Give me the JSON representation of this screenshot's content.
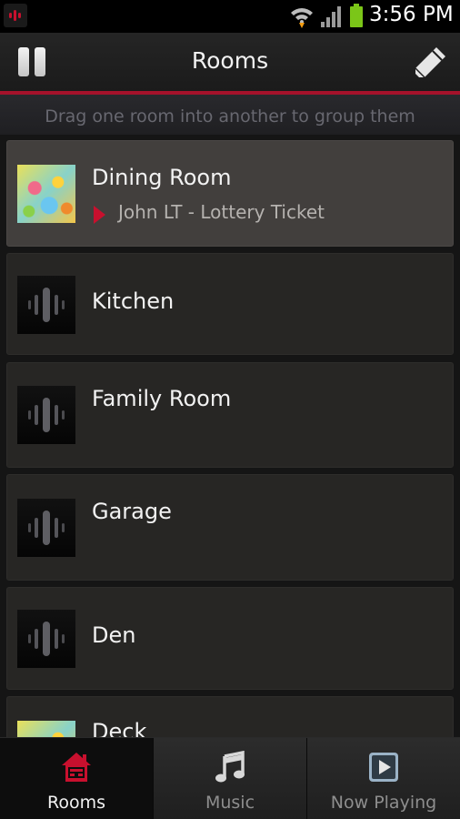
{
  "status_bar": {
    "time": "3:56 PM",
    "icons": [
      "sonos-app-icon",
      "wifi-icon",
      "signal-icon",
      "battery-icon"
    ],
    "battery_color": "#7bc618"
  },
  "header": {
    "title": "Rooms",
    "left_icon": "pause-icon",
    "right_icon": "pencil-edit-icon",
    "accent_color": "#a5122b"
  },
  "hint": {
    "text": "Drag one room into another to group them"
  },
  "rooms": [
    {
      "name": "Dining Room",
      "now_playing": "John LT - Lottery Ticket",
      "thumb": "album-art",
      "selected": true
    },
    {
      "name": "Kitchen",
      "now_playing": "",
      "thumb": "speaker-icon",
      "selected": false
    },
    {
      "name": "Family Room",
      "now_playing": "",
      "thumb": "speaker-icon",
      "selected": false
    },
    {
      "name": "Garage",
      "now_playing": "",
      "thumb": "speaker-icon",
      "selected": false
    },
    {
      "name": "Den",
      "now_playing": "",
      "thumb": "speaker-icon",
      "selected": false
    },
    {
      "name": "Deck",
      "now_playing": "",
      "thumb": "album-art",
      "selected": false
    }
  ],
  "bottom_nav": {
    "tabs": [
      {
        "label": "Rooms",
        "icon": "house-icon",
        "active": true
      },
      {
        "label": "Music",
        "icon": "music-note-icon",
        "active": false
      },
      {
        "label": "Now Playing",
        "icon": "play-box-icon",
        "active": false
      }
    ]
  }
}
